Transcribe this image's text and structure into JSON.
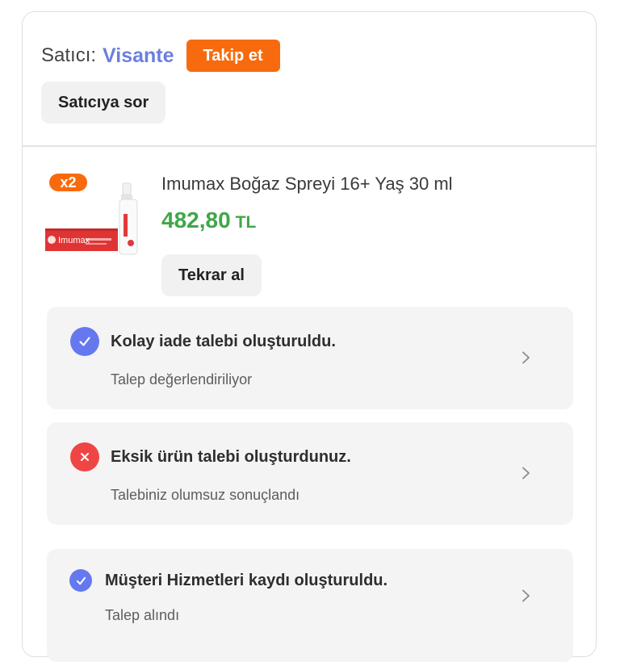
{
  "seller": {
    "label": "Satıcı:",
    "name": "Visante",
    "follow_label": "Takip et",
    "ask_label": "Satıcıya sor"
  },
  "product": {
    "quantity_badge": "x2",
    "title": "Imumax Boğaz Spreyi 16+ Yaş 30 ml",
    "price": "482,80",
    "currency": "TL",
    "rebuy_label": "Tekrar al",
    "image_brand_text": "Imumax"
  },
  "statuses": [
    {
      "icon": "check-icon",
      "title": "Kolay iade talebi oluşturuldu.",
      "subtitle": "Talep değerlendiriliyor"
    },
    {
      "icon": "close-icon",
      "title": "Eksik ürün talebi oluşturdunuz.",
      "subtitle": "Talebiniz olumsuz sonuçlandı"
    },
    {
      "icon": "check-icon",
      "title": "Müşteri Hizmetleri kaydı oluşturuldu.",
      "subtitle": "Talep alındı"
    }
  ],
  "colors": {
    "accent_orange": "#f76b0e",
    "seller_blue": "#6b7fe0",
    "price_green": "#3fa64a",
    "status_blue": "#6578f0",
    "status_red": "#f04545"
  }
}
